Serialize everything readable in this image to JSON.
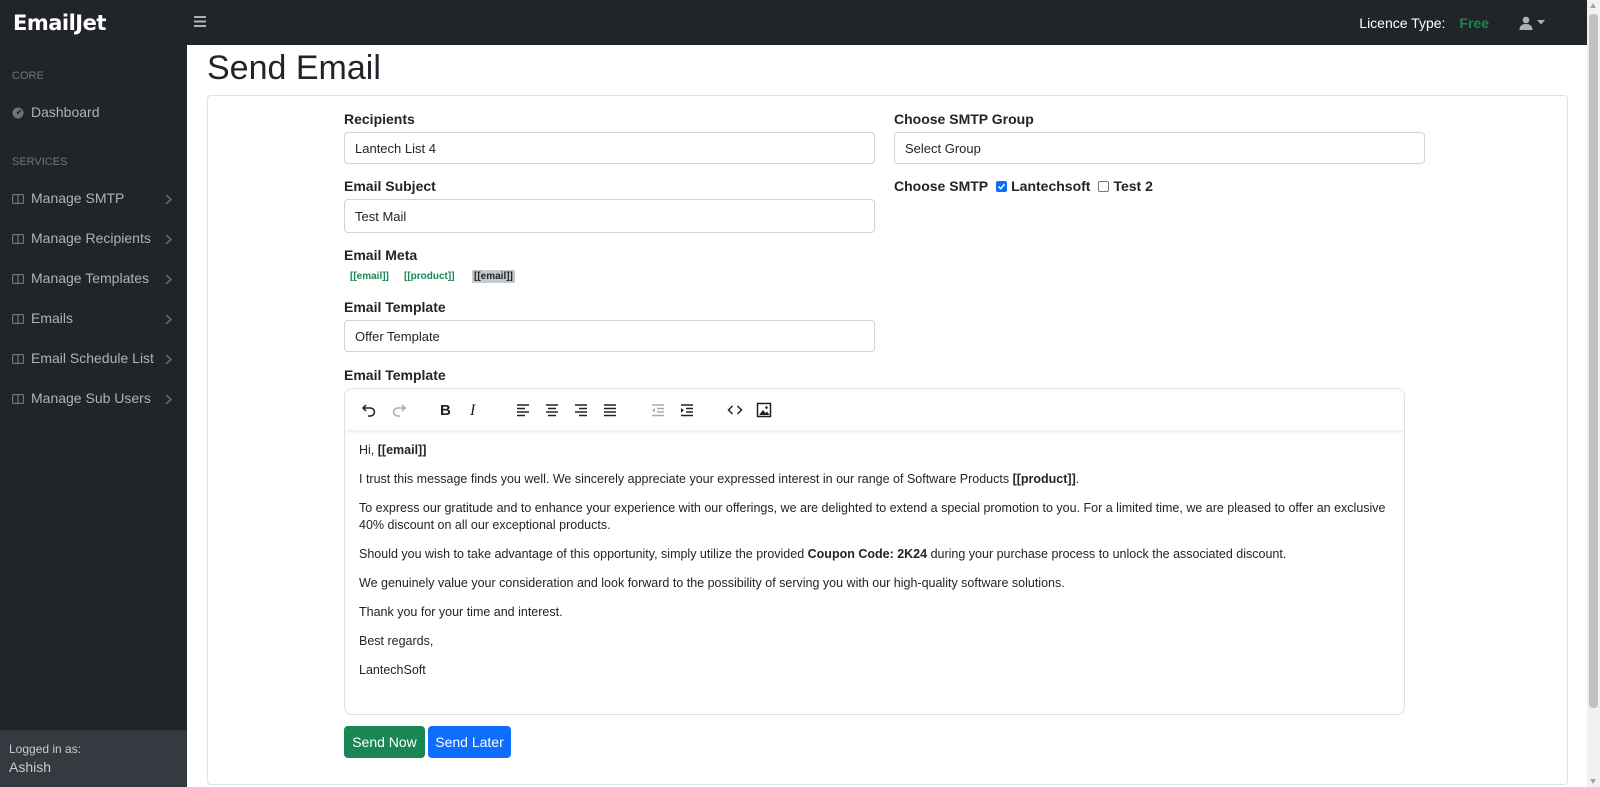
{
  "app": {
    "brand": "EmailJet",
    "licence_label": "Licence Type:",
    "licence_value": "Free",
    "hamburger_icon": "bars-icon",
    "user_icon": "user-icon"
  },
  "sidebar": {
    "headings": [
      "CORE",
      "SERVICES"
    ],
    "dashboard": "Dashboard",
    "items": [
      {
        "label": "Manage SMTP"
      },
      {
        "label": "Manage Recipients"
      },
      {
        "label": "Manage Templates"
      },
      {
        "label": "Emails"
      },
      {
        "label": "Email Schedule List"
      },
      {
        "label": "Manage Sub Users"
      }
    ],
    "footer_label": "Logged in as:",
    "footer_user": "Ashish"
  },
  "page": {
    "title": "Send Email"
  },
  "form": {
    "recipients_label": "Recipients",
    "recipients_value": "Lantech List 4",
    "smtp_group_label": "Choose SMTP Group",
    "smtp_group_value": "Select Group",
    "subject_label": "Email Subject",
    "subject_value": "Test Mail",
    "choose_smtp_label": "Choose SMTP",
    "smtp_options": [
      {
        "label": "Lantechsoft",
        "checked": true
      },
      {
        "label": "Test 2",
        "checked": false
      }
    ],
    "meta_label": "Email Meta",
    "meta_tags": [
      "[[email]]",
      "[[product]]",
      "[[email]]"
    ],
    "template_label": "Email Template",
    "template_value": "Offer Template",
    "editor_label": "Email Template"
  },
  "editor": {
    "greeting": "Hi, ",
    "greeting_tag": "[[email]]",
    "p1": "I trust this message finds you well. We sincerely appreciate your expressed interest in our range of Software Products ",
    "p1_tag": "[[product]]",
    "p1_end": ".",
    "p2": "To express our gratitude and to enhance your experience with our offerings, we are delighted to extend a special promotion to you. For a limited time, we are pleased to offer an exclusive 40% discount on all our exceptional products.",
    "p3_start": "Should you wish to take advantage of this opportunity, simply utilize the provided ",
    "p3_code": "Coupon Code: 2K24",
    "p3_end": " during your purchase process to unlock the associated discount.",
    "p4": "We genuinely value your consideration and look forward to the possibility of serving you with our high-quality software solutions.",
    "p5": "Thank you for your time and interest.",
    "p6": "Best regards,",
    "p7": "LantechSoft"
  },
  "buttons": {
    "send_now": "Send Now",
    "send_later": "Send Later"
  },
  "colors": {
    "dark": "#212529",
    "green": "#198754",
    "blue": "#0d6efd"
  }
}
